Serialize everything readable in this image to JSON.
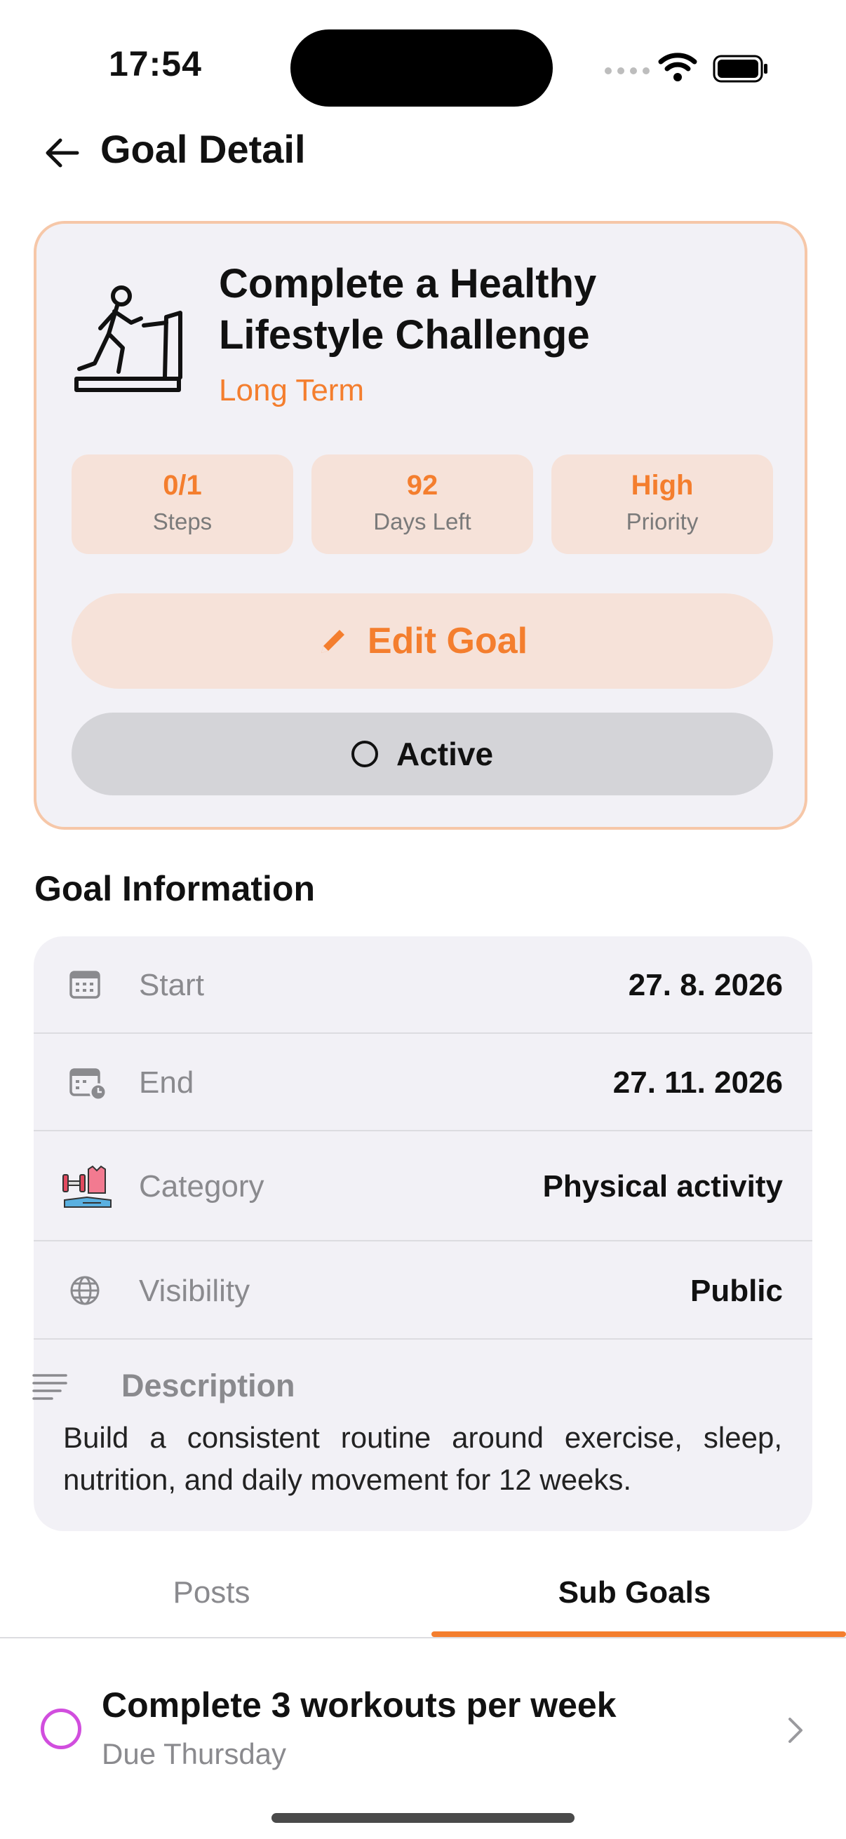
{
  "status_bar": {
    "time": "17:54"
  },
  "header": {
    "title": "Goal Detail"
  },
  "goal": {
    "title": "Complete a Healthy Lifestyle Challenge",
    "term": "Long Term",
    "stats": [
      {
        "value": "0/1",
        "label": "Steps"
      },
      {
        "value": "92",
        "label": "Days Left"
      },
      {
        "value": "High",
        "label": "Priority"
      }
    ],
    "edit_label": "Edit Goal",
    "status_label": "Active"
  },
  "info": {
    "section_title": "Goal Information",
    "rows": [
      {
        "label": "Start",
        "value": "27. 8. 2026"
      },
      {
        "label": "End",
        "value": "27. 11. 2026"
      },
      {
        "label": "Category",
        "value": "Physical activity"
      },
      {
        "label": "Visibility",
        "value": "Public"
      }
    ],
    "description_label": "Description",
    "description": "Build a consistent routine around exercise, sleep, nutrition, and daily movement for 12 weeks."
  },
  "tabs": [
    {
      "label": "Posts"
    },
    {
      "label": "Sub Goals"
    }
  ],
  "sub_goals": [
    {
      "title": "Complete 3 workouts per week",
      "due": "Due Thursday"
    }
  ],
  "colors": {
    "accent": "#f47e2e",
    "card_border": "#f6c7a8",
    "subgoal_ring": "#d14ede"
  }
}
